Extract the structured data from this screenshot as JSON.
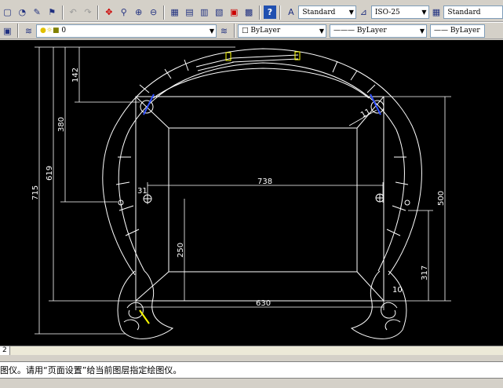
{
  "toolbar": {
    "text_style": "Standard",
    "dim_style": "ISO-25",
    "table_style": "Standard",
    "layer_name": "0",
    "color": "ByLayer",
    "linetype": "ByLayer",
    "lineweight": "ByLayer"
  },
  "dimensions": {
    "d142": "142",
    "d380": "380",
    "d619": "619",
    "d715": "715",
    "d738": "738",
    "d31": "31",
    "d250": "250",
    "d630": "630",
    "d500": "500",
    "d317": "317",
    "d11": "11",
    "d10": "10"
  },
  "tabs": {
    "active": "2"
  },
  "command": {
    "text": "图仪。请用“页面设置”给当前图层指定绘图仪。"
  },
  "colors": {
    "canvas": "#000000",
    "lines": "#ffffff",
    "accent_yellow": "#ffff00",
    "accent_blue": "#3050ff"
  }
}
